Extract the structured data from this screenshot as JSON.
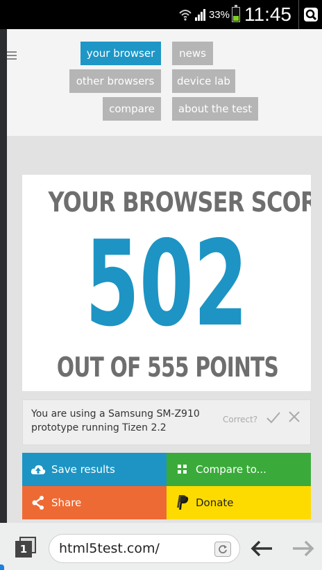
{
  "status": {
    "battery_pct": "33%",
    "battery_level": 0.33,
    "time": "11:45"
  },
  "nav": {
    "items": [
      {
        "label": "your browser",
        "active": true
      },
      {
        "label": "news"
      },
      {
        "label": "other browsers"
      },
      {
        "label": "device lab"
      },
      {
        "label": "compare"
      },
      {
        "label": "about the test"
      }
    ]
  },
  "score": {
    "title": "YOUR BROWSER SCORES",
    "value": "502",
    "subtitle": "OUT OF 555 POINTS"
  },
  "device": {
    "text": "You are using a Samsung SM-Z910 prototype running Tizen 2.2",
    "correct_label": "Correct?"
  },
  "actions": {
    "save": "Save results",
    "compare": "Compare to...",
    "share": "Share",
    "donate": "Donate"
  },
  "browser": {
    "tab_count": "1",
    "url": "html5test.com/"
  },
  "colors": {
    "accent_blue": "#1d94c3",
    "green": "#3aab3a",
    "orange": "#ee6a34",
    "yellow": "#fedb00",
    "nav_grey": "#b5b5b5"
  }
}
